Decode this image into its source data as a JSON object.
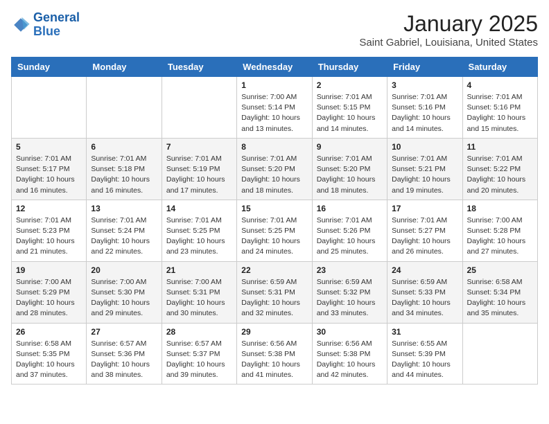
{
  "header": {
    "logo_line1": "General",
    "logo_line2": "Blue",
    "month_year": "January 2025",
    "location": "Saint Gabriel, Louisiana, United States"
  },
  "days_of_week": [
    "Sunday",
    "Monday",
    "Tuesday",
    "Wednesday",
    "Thursday",
    "Friday",
    "Saturday"
  ],
  "weeks": [
    [
      {
        "day": "",
        "info": ""
      },
      {
        "day": "",
        "info": ""
      },
      {
        "day": "",
        "info": ""
      },
      {
        "day": "1",
        "info": "Sunrise: 7:00 AM\nSunset: 5:14 PM\nDaylight: 10 hours\nand 13 minutes."
      },
      {
        "day": "2",
        "info": "Sunrise: 7:01 AM\nSunset: 5:15 PM\nDaylight: 10 hours\nand 14 minutes."
      },
      {
        "day": "3",
        "info": "Sunrise: 7:01 AM\nSunset: 5:16 PM\nDaylight: 10 hours\nand 14 minutes."
      },
      {
        "day": "4",
        "info": "Sunrise: 7:01 AM\nSunset: 5:16 PM\nDaylight: 10 hours\nand 15 minutes."
      }
    ],
    [
      {
        "day": "5",
        "info": "Sunrise: 7:01 AM\nSunset: 5:17 PM\nDaylight: 10 hours\nand 16 minutes."
      },
      {
        "day": "6",
        "info": "Sunrise: 7:01 AM\nSunset: 5:18 PM\nDaylight: 10 hours\nand 16 minutes."
      },
      {
        "day": "7",
        "info": "Sunrise: 7:01 AM\nSunset: 5:19 PM\nDaylight: 10 hours\nand 17 minutes."
      },
      {
        "day": "8",
        "info": "Sunrise: 7:01 AM\nSunset: 5:20 PM\nDaylight: 10 hours\nand 18 minutes."
      },
      {
        "day": "9",
        "info": "Sunrise: 7:01 AM\nSunset: 5:20 PM\nDaylight: 10 hours\nand 18 minutes."
      },
      {
        "day": "10",
        "info": "Sunrise: 7:01 AM\nSunset: 5:21 PM\nDaylight: 10 hours\nand 19 minutes."
      },
      {
        "day": "11",
        "info": "Sunrise: 7:01 AM\nSunset: 5:22 PM\nDaylight: 10 hours\nand 20 minutes."
      }
    ],
    [
      {
        "day": "12",
        "info": "Sunrise: 7:01 AM\nSunset: 5:23 PM\nDaylight: 10 hours\nand 21 minutes."
      },
      {
        "day": "13",
        "info": "Sunrise: 7:01 AM\nSunset: 5:24 PM\nDaylight: 10 hours\nand 22 minutes."
      },
      {
        "day": "14",
        "info": "Sunrise: 7:01 AM\nSunset: 5:25 PM\nDaylight: 10 hours\nand 23 minutes."
      },
      {
        "day": "15",
        "info": "Sunrise: 7:01 AM\nSunset: 5:25 PM\nDaylight: 10 hours\nand 24 minutes."
      },
      {
        "day": "16",
        "info": "Sunrise: 7:01 AM\nSunset: 5:26 PM\nDaylight: 10 hours\nand 25 minutes."
      },
      {
        "day": "17",
        "info": "Sunrise: 7:01 AM\nSunset: 5:27 PM\nDaylight: 10 hours\nand 26 minutes."
      },
      {
        "day": "18",
        "info": "Sunrise: 7:00 AM\nSunset: 5:28 PM\nDaylight: 10 hours\nand 27 minutes."
      }
    ],
    [
      {
        "day": "19",
        "info": "Sunrise: 7:00 AM\nSunset: 5:29 PM\nDaylight: 10 hours\nand 28 minutes."
      },
      {
        "day": "20",
        "info": "Sunrise: 7:00 AM\nSunset: 5:30 PM\nDaylight: 10 hours\nand 29 minutes."
      },
      {
        "day": "21",
        "info": "Sunrise: 7:00 AM\nSunset: 5:31 PM\nDaylight: 10 hours\nand 30 minutes."
      },
      {
        "day": "22",
        "info": "Sunrise: 6:59 AM\nSunset: 5:31 PM\nDaylight: 10 hours\nand 32 minutes."
      },
      {
        "day": "23",
        "info": "Sunrise: 6:59 AM\nSunset: 5:32 PM\nDaylight: 10 hours\nand 33 minutes."
      },
      {
        "day": "24",
        "info": "Sunrise: 6:59 AM\nSunset: 5:33 PM\nDaylight: 10 hours\nand 34 minutes."
      },
      {
        "day": "25",
        "info": "Sunrise: 6:58 AM\nSunset: 5:34 PM\nDaylight: 10 hours\nand 35 minutes."
      }
    ],
    [
      {
        "day": "26",
        "info": "Sunrise: 6:58 AM\nSunset: 5:35 PM\nDaylight: 10 hours\nand 37 minutes."
      },
      {
        "day": "27",
        "info": "Sunrise: 6:57 AM\nSunset: 5:36 PM\nDaylight: 10 hours\nand 38 minutes."
      },
      {
        "day": "28",
        "info": "Sunrise: 6:57 AM\nSunset: 5:37 PM\nDaylight: 10 hours\nand 39 minutes."
      },
      {
        "day": "29",
        "info": "Sunrise: 6:56 AM\nSunset: 5:38 PM\nDaylight: 10 hours\nand 41 minutes."
      },
      {
        "day": "30",
        "info": "Sunrise: 6:56 AM\nSunset: 5:38 PM\nDaylight: 10 hours\nand 42 minutes."
      },
      {
        "day": "31",
        "info": "Sunrise: 6:55 AM\nSunset: 5:39 PM\nDaylight: 10 hours\nand 44 minutes."
      },
      {
        "day": "",
        "info": ""
      }
    ]
  ]
}
